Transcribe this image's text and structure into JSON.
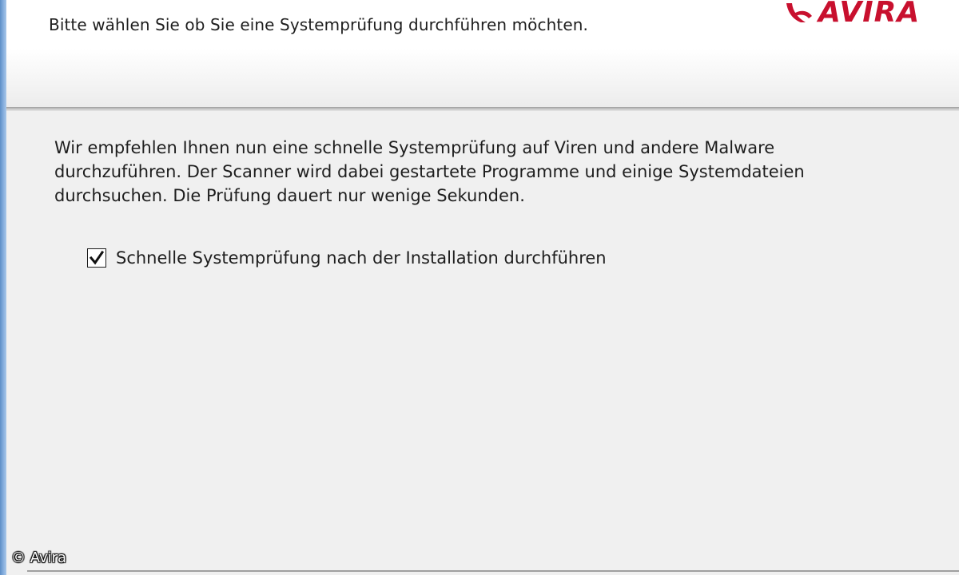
{
  "header": {
    "subtitle": "Bitte wählen Sie ob Sie eine Systemprüfung durchführen möchten.",
    "logo_text": "AVIRA",
    "logo_icon": "avira-umbrella-icon",
    "brand_color": "#c8102e"
  },
  "main": {
    "description_lines": [
      "Wir empfehlen Ihnen nun eine schnelle Systemprüfung auf Viren und andere Malware",
      "durchzuführen. Der Scanner wird dabei gestartete Programme und einige Systemdateien",
      "durchsuchen. Die Prüfung dauert nur wenige Sekunden."
    ],
    "checkbox": {
      "label": "Schnelle Systemprüfung nach der Installation durchführen",
      "checked": true
    }
  },
  "watermark": {
    "text": "© Avira"
  }
}
